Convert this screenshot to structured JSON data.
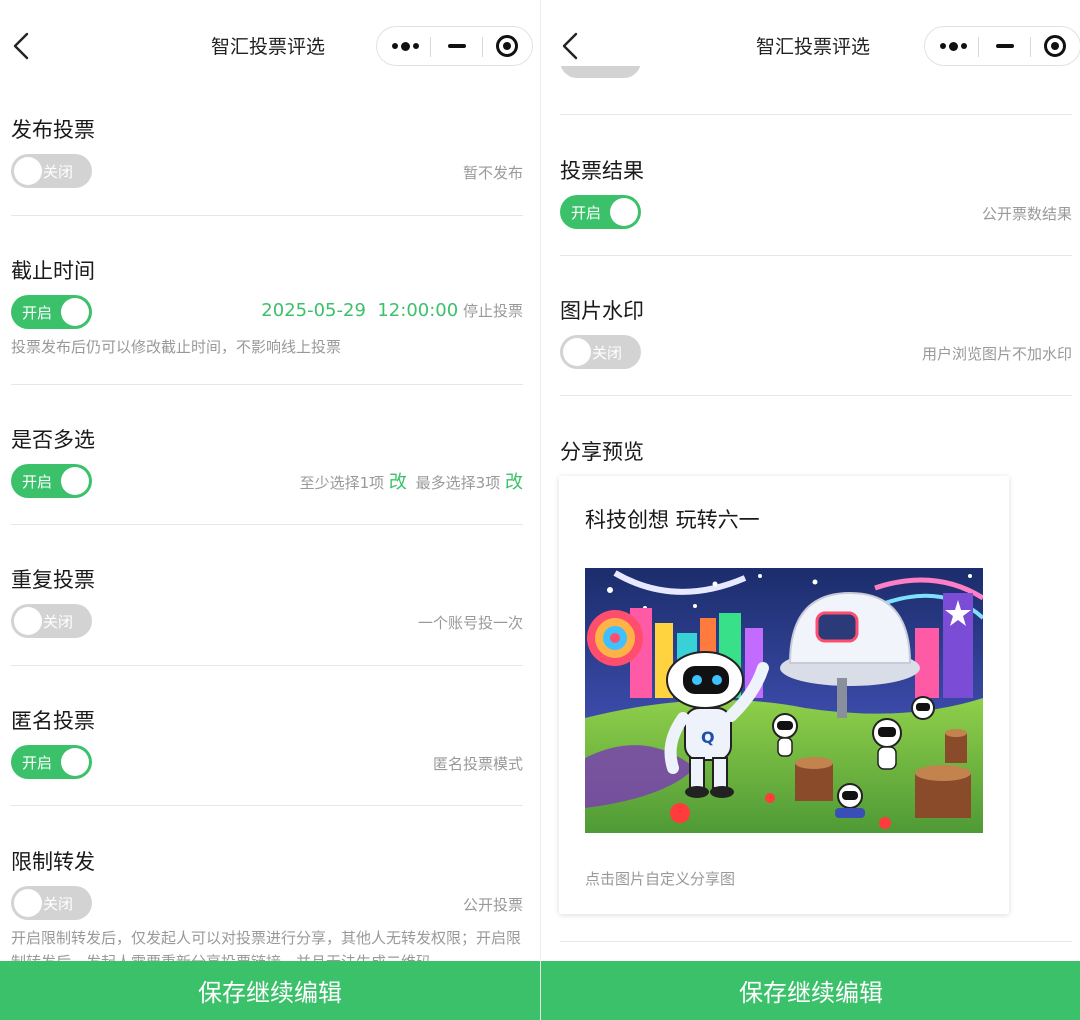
{
  "nav": {
    "title": "智汇投票评选"
  },
  "left": {
    "publish": {
      "title": "发布投票",
      "switch": "关闭",
      "note": "暂不发布"
    },
    "deadline": {
      "title": "截止时间",
      "switch": "开启",
      "date": "2025-05-29  12:00:00",
      "suffix": "停止投票",
      "hint": "投票发布后仍可以修改截止时间，不影响线上投票"
    },
    "multi": {
      "title": "是否多选",
      "switch": "开启",
      "min_text": "至少选择1项",
      "max_text": "最多选择3项",
      "edit": "改"
    },
    "repeat": {
      "title": "重复投票",
      "switch": "关闭",
      "note": "一个账号投一次"
    },
    "anonymous": {
      "title": "匿名投票",
      "switch": "开启",
      "note": "匿名投票模式"
    },
    "restrict": {
      "title": "限制转发",
      "switch": "关闭",
      "note": "公开投票",
      "hint": "开启限制转发后，仅发起人可以对投票进行分享，其他人无转发权限；开启限制转发后，发起人需要重新分享投票链接，并且无法生成二维码"
    }
  },
  "right": {
    "result": {
      "title": "投票结果",
      "switch": "开启",
      "note": "公开票数结果"
    },
    "watermark": {
      "title": "图片水印",
      "switch": "关闭",
      "note": "用户浏览图片不加水印"
    },
    "share": {
      "title": "分享预览",
      "card_title": "科技创想 玩转六一",
      "hint": "点击图片自定义分享图"
    }
  },
  "save_button": "保存继续编辑",
  "colors": {
    "accent": "#3cc16b",
    "switch_off": "#d3d3d3"
  }
}
